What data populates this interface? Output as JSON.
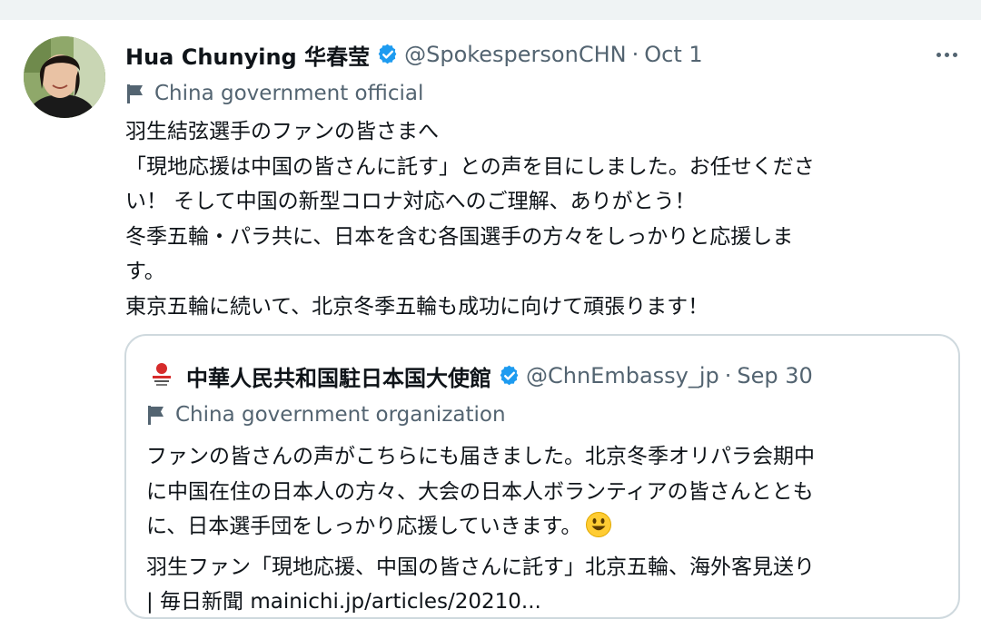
{
  "tweet": {
    "author_name": "Hua Chunying 华春莹",
    "handle": "@SpokespersonCHN",
    "separator": "·",
    "date": "Oct 1",
    "label": "China government official",
    "lines": [
      "羽生結弦選手のファンの皆さまへ",
      "「現地応援は中国の皆さんに託す」との声を目にしました。お任せくださ",
      "い！ そして中国の新型コロナ対応へのご理解、ありがとう！",
      "冬季五輪・パラ共に、日本を含む各国選手の方々をしっかりと応援しま",
      "す。",
      "東京五輪に続いて、北京冬季五輪も成功に向けて頑張ります！"
    ]
  },
  "quoted": {
    "author_name": "中華人民共和国駐日本国大使館",
    "handle": "@ChnEmbassy_jp",
    "separator": "·",
    "date": "Sep 30",
    "label": "China government organization",
    "lines": [
      "ファンの皆さんの声がこちらにも届きました。北京冬季オリパラ会期中",
      "に中国在住の日本人の方々、大会の日本人ボランティアの皆さんととも",
      "に、日本選手団をしっかり応援していきます。",
      "羽生ファン「現地応援、中国の皆さんに託す」北京五輪、海外客見送り",
      "| 毎日新聞 mainichi.jp/articles/20210..."
    ]
  },
  "icons": {
    "verified": "verified-badge-icon",
    "flag": "flag-icon",
    "more": "more-options-icon",
    "emoji": "smiley-emoji-icon"
  },
  "colors": {
    "verified": "#1d9bf0",
    "secondary_text": "#536471",
    "primary_text": "#0f1419",
    "border": "#cfd9de"
  }
}
